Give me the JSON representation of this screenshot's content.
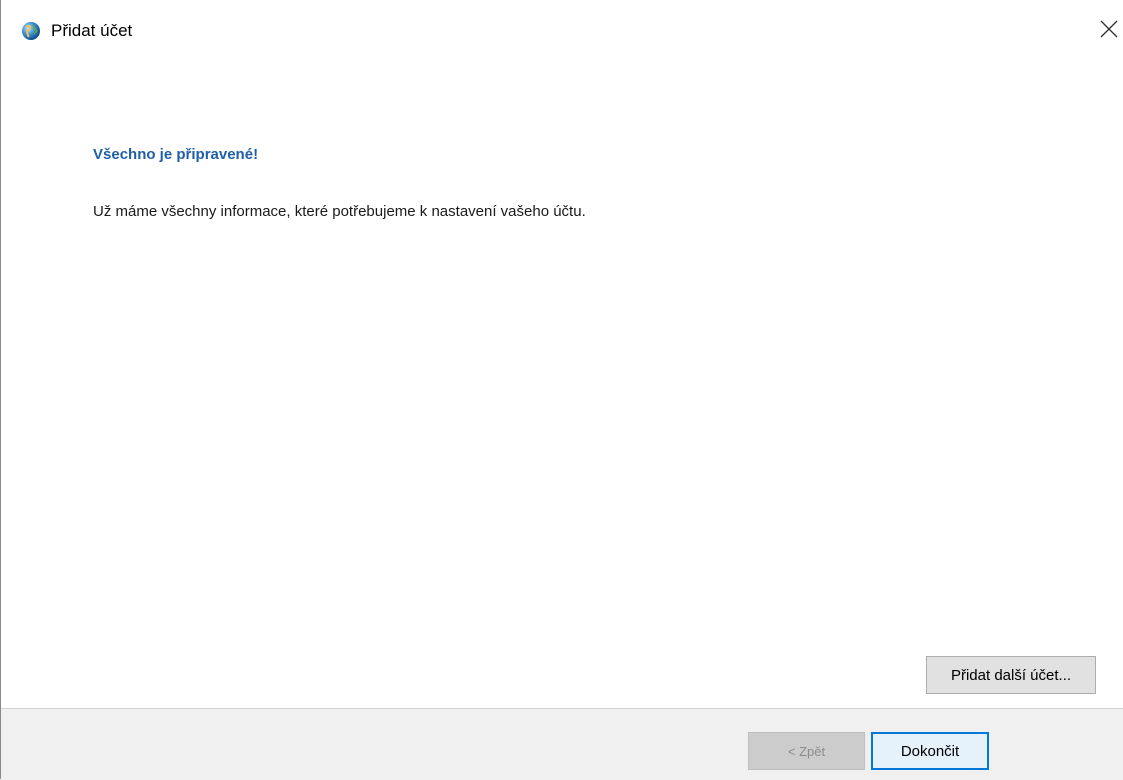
{
  "window": {
    "title": "Přidat účet",
    "icon": "outlook-globe-icon",
    "close_glyph": "✕"
  },
  "content": {
    "heading": "Všechno je připravené!",
    "description": "Už máme všechny informace, které potřebujeme k nastavení vašeho účtu.",
    "add_another_label": "Přidat další účet..."
  },
  "footer": {
    "back_label": "< Zpět",
    "finish_label": "Dokončit"
  },
  "colors": {
    "heading": "#1f5fa8",
    "footer_bg": "#f0f0f0",
    "default_button_border": "#0078d7"
  }
}
